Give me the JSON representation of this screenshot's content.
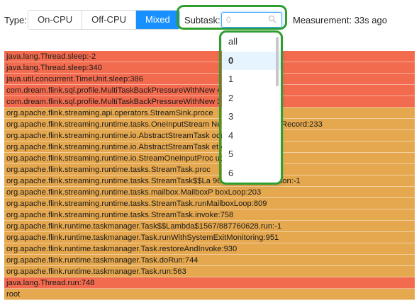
{
  "toolbar": {
    "type_label": "Type:",
    "type_options": [
      "On-CPU",
      "Off-CPU",
      "Mixed"
    ],
    "type_selected": "Mixed",
    "subtask_label": "Subtask:",
    "subtask_value": "0",
    "measurement": "Measurement: 33s ago"
  },
  "dropdown": {
    "options": [
      "all",
      "0",
      "1",
      "2",
      "3",
      "4",
      "5",
      "6"
    ],
    "selected": "0"
  },
  "colors": {
    "accent": "#1890ff",
    "highlight": "#2e9e2e",
    "java": "#f26b4e",
    "flink": "#e5a84f"
  },
  "frames": [
    {
      "label": "java.lang.Thread.sleep:-2",
      "kind": "java"
    },
    {
      "label": "java.lang.Thread.sleep:340",
      "kind": "java"
    },
    {
      "label": "java.util.concurrent.TimeUnit.sleep:386",
      "kind": "java"
    },
    {
      "label": "com.dream.flink.sql.profile.MultiTaskBackPressureWithNew                44",
      "kind": "java"
    },
    {
      "label": "com.dream.flink.sql.profile.MultiTaskBackPressureWithNew                39",
      "kind": "java"
    },
    {
      "label": "org.apache.flink.streaming.api.operators.StreamSink.proce",
      "kind": "flink"
    },
    {
      "label": "org.apache.flink.streaming.runtime.tasks.OneInputStream              NetworkOutput.emitRecord:233",
      "kind": "flink"
    },
    {
      "label": "org.apache.flink.streaming.runtime.io.AbstractStreamTask              ocessElement:134",
      "kind": "flink"
    },
    {
      "label": "org.apache.flink.streaming.runtime.io.AbstractStreamTask              etNext:105",
      "kind": "flink"
    },
    {
      "label": "org.apache.flink.streaming.runtime.io.StreamOneInputProc              ut:65",
      "kind": "flink"
    },
    {
      "label": "org.apache.flink.streaming.runtime.tasks.StreamTask.proc",
      "kind": "flink"
    },
    {
      "label": "org.apache.flink.streaming.runtime.tasks.StreamTask$$La              9602.runDefaultAction:-1",
      "kind": "flink"
    },
    {
      "label": "org.apache.flink.streaming.runtime.tasks.mailbox.MailboxP              boxLoop:203",
      "kind": "flink"
    },
    {
      "label": "org.apache.flink.streaming.runtime.tasks.StreamTask.runMailboxLoop:809",
      "kind": "flink"
    },
    {
      "label": "org.apache.flink.streaming.runtime.tasks.StreamTask.invoke:758",
      "kind": "flink"
    },
    {
      "label": "org.apache.flink.runtime.taskmanager.Task$$Lambda$1567/887760628.run:-1",
      "kind": "flink"
    },
    {
      "label": "org.apache.flink.runtime.taskmanager.Task.runWithSystemExitMonitoring:951",
      "kind": "flink"
    },
    {
      "label": "org.apache.flink.runtime.taskmanager.Task.restoreAndInvoke:930",
      "kind": "flink"
    },
    {
      "label": "org.apache.flink.runtime.taskmanager.Task.doRun:744",
      "kind": "flink"
    },
    {
      "label": "org.apache.flink.runtime.taskmanager.Task.run:563",
      "kind": "flink"
    },
    {
      "label": "java.lang.Thread.run:748",
      "kind": "java"
    },
    {
      "label": "root",
      "kind": "flink"
    }
  ]
}
